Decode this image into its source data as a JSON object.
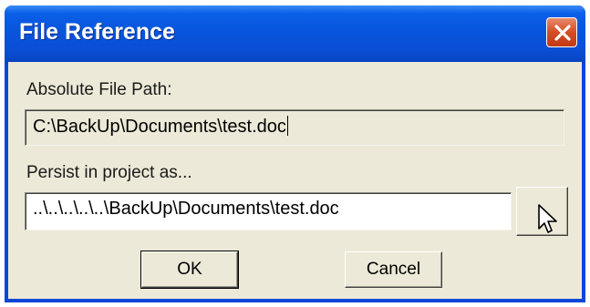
{
  "window": {
    "title": "File Reference",
    "close_icon": "close-icon"
  },
  "absolute_path": {
    "label": "Absolute File Path:",
    "value": "C:\\BackUp\\Documents\\test.doc"
  },
  "persist": {
    "label": "Persist in project as...",
    "value": "..\\..\\..\\..\\..\\BackUp\\Documents\\test.doc",
    "browse_icon": "cursor-icon"
  },
  "buttons": {
    "ok_label": "OK",
    "cancel_label": "Cancel"
  },
  "colors": {
    "titlebar": "#0a4ed4",
    "dialog_face": "#ece9d8",
    "close_button": "#d54c24"
  }
}
